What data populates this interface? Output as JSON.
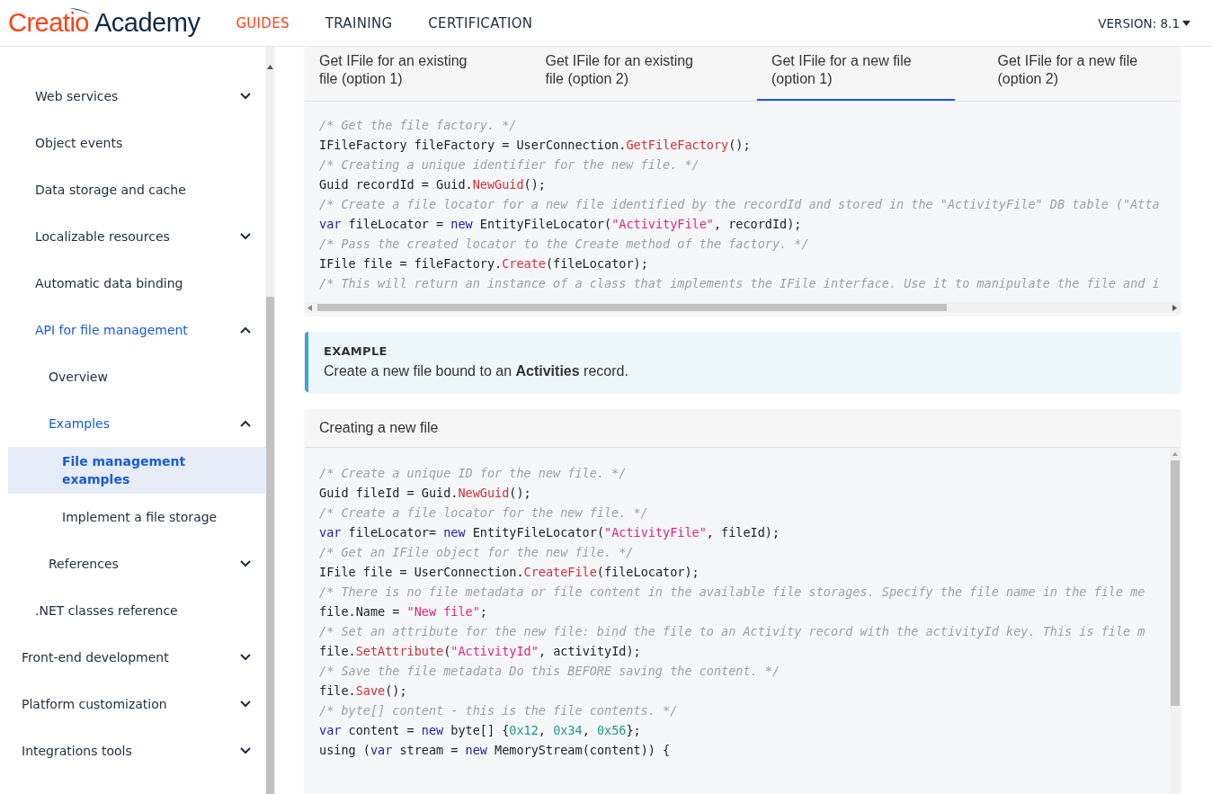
{
  "header": {
    "logo": {
      "brand": "Creatio",
      "name": "Academy"
    },
    "nav": [
      {
        "label": "GUIDES",
        "selected": true
      },
      {
        "label": "TRAINING",
        "selected": false
      },
      {
        "label": "CERTIFICATION",
        "selected": false
      }
    ],
    "version": "VERSION: 8.1"
  },
  "sidebar": {
    "section_items": [
      {
        "label": "Web services",
        "expanded": false,
        "selected": false
      },
      {
        "label": "Object events",
        "selected": false
      },
      {
        "label": "Data storage and cache",
        "selected": false
      },
      {
        "label": "Localizable resources",
        "expanded": false,
        "selected": false
      },
      {
        "label": "Automatic data binding",
        "selected": false
      },
      {
        "label": "API for file management",
        "expanded": true,
        "selected": false,
        "children": [
          {
            "label": "Overview",
            "selected": false
          },
          {
            "label": "Examples",
            "expanded": true,
            "selected": false,
            "children": [
              {
                "label": "File management examples",
                "selected": true
              },
              {
                "label": "Implement a file storage",
                "selected": false
              }
            ]
          },
          {
            "label": "References",
            "expanded": false,
            "selected": false
          }
        ]
      },
      {
        "label": ".NET classes reference",
        "selected": false
      }
    ],
    "items": [
      {
        "label": "Front-end development",
        "expanded": false,
        "selected": false
      },
      {
        "label": "Platform customization",
        "expanded": false,
        "selected": false
      },
      {
        "label": "Integrations tools",
        "expanded": false,
        "selected": false
      }
    ]
  },
  "tabs": [
    {
      "label": "Get IFile for an existing file (option 1)",
      "selected": false
    },
    {
      "label": "Get IFile for an existing file (option 2)",
      "selected": false
    },
    {
      "label": "Get IFile for a new file (option 1)",
      "selected": true
    },
    {
      "label": "Get IFile for a new file (option 2)",
      "selected": false
    }
  ],
  "code_1": [
    [
      {
        "kind": "comment",
        "text": "/* Get the file factory. */"
      }
    ],
    [
      {
        "kind": "plain",
        "text": "IFileFactory fileFactory = UserConnection."
      },
      {
        "kind": "method",
        "text": "GetFileFactory"
      },
      {
        "kind": "plain",
        "text": "();"
      }
    ],
    [
      {
        "kind": "comment",
        "text": "/* Creating a unique identifier for the new file. */"
      }
    ],
    [
      {
        "kind": "plain",
        "text": "Guid recordId = Guid."
      },
      {
        "kind": "method",
        "text": "NewGuid"
      },
      {
        "kind": "plain",
        "text": "();"
      }
    ],
    [
      {
        "kind": "comment",
        "text": "/* Create a file locator for a new file identified by the recordId and stored in the \"ActivityFile\" DB table (\"Atta"
      }
    ],
    [
      {
        "kind": "keyword",
        "text": "var"
      },
      {
        "kind": "plain",
        "text": " fileLocator = "
      },
      {
        "kind": "keyword",
        "text": "new"
      },
      {
        "kind": "plain",
        "text": " EntityFileLocator("
      },
      {
        "kind": "string",
        "text": "\"ActivityFile\""
      },
      {
        "kind": "plain",
        "text": ", recordId);"
      }
    ],
    [
      {
        "kind": "comment",
        "text": "/* Pass the created locator to the Create method of the factory. */"
      }
    ],
    [
      {
        "kind": "plain",
        "text": "IFile file = fileFactory."
      },
      {
        "kind": "method",
        "text": "Create"
      },
      {
        "kind": "plain",
        "text": "(fileLocator);"
      }
    ],
    [
      {
        "kind": "comment",
        "text": "/* This will return an instance of a class that implements the IFile interface. Use it to manipulate the file and i"
      }
    ]
  ],
  "example": {
    "label": "EXAMPLE",
    "text": "Create a new file bound to an **Activities** record."
  },
  "code_card": {
    "title": "Creating a new file",
    "lines": [
      [
        {
          "kind": "comment",
          "text": "/* Create a unique ID for the new file. */"
        }
      ],
      [
        {
          "kind": "plain",
          "text": "Guid fileId = Guid."
        },
        {
          "kind": "method",
          "text": "NewGuid"
        },
        {
          "kind": "plain",
          "text": "();"
        }
      ],
      [
        {
          "kind": "comment",
          "text": "/* Create a file locator for the new file. */"
        }
      ],
      [
        {
          "kind": "keyword",
          "text": "var"
        },
        {
          "kind": "plain",
          "text": " fileLocator= "
        },
        {
          "kind": "keyword",
          "text": "new"
        },
        {
          "kind": "plain",
          "text": " EntityFileLocator("
        },
        {
          "kind": "string",
          "text": "\"ActivityFile\""
        },
        {
          "kind": "plain",
          "text": ", fileId);"
        }
      ],
      [
        {
          "kind": "comment",
          "text": "/* Get an IFile object for the new file. */"
        }
      ],
      [
        {
          "kind": "plain",
          "text": "IFile file = UserConnection."
        },
        {
          "kind": "method",
          "text": "CreateFile"
        },
        {
          "kind": "plain",
          "text": "(fileLocator);"
        }
      ],
      [
        {
          "kind": "comment",
          "text": "/* There is no file metadata or file content in the available file storages. Specify the file name in the file me"
        }
      ],
      [
        {
          "kind": "plain",
          "text": "file.Name = "
        },
        {
          "kind": "string",
          "text": "\"New file\""
        },
        {
          "kind": "plain",
          "text": ";"
        }
      ],
      [
        {
          "kind": "comment",
          "text": "/* Set an attribute for the new file: bind the file to an Activity record with the activityId key. This is file m"
        }
      ],
      [
        {
          "kind": "plain",
          "text": "file."
        },
        {
          "kind": "method",
          "text": "SetAttribute"
        },
        {
          "kind": "plain",
          "text": "("
        },
        {
          "kind": "string",
          "text": "\"ActivityId\""
        },
        {
          "kind": "plain",
          "text": ", activityId);"
        }
      ],
      [
        {
          "kind": "comment",
          "text": "/* Save the file metadata Do this BEFORE saving the content. */"
        }
      ],
      [
        {
          "kind": "plain",
          "text": "file."
        },
        {
          "kind": "method",
          "text": "Save"
        },
        {
          "kind": "plain",
          "text": "();"
        }
      ],
      [
        {
          "kind": "comment",
          "text": "/* byte[] content - this is the file contents. */"
        }
      ],
      [
        {
          "kind": "keyword",
          "text": "var"
        },
        {
          "kind": "plain",
          "text": " content = "
        },
        {
          "kind": "keyword",
          "text": "new"
        },
        {
          "kind": "plain",
          "text": " byte[] {"
        },
        {
          "kind": "number",
          "text": "0x12"
        },
        {
          "kind": "plain",
          "text": ", "
        },
        {
          "kind": "number",
          "text": "0x34"
        },
        {
          "kind": "plain",
          "text": ", "
        },
        {
          "kind": "number",
          "text": "0x56"
        },
        {
          "kind": "plain",
          "text": "};"
        }
      ],
      [
        {
          "kind": "plain",
          "text": "using ("
        },
        {
          "kind": "keyword",
          "text": "var"
        },
        {
          "kind": "plain",
          "text": " stream = "
        },
        {
          "kind": "keyword",
          "text": "new"
        },
        {
          "kind": "plain",
          "text": " MemoryStream(content)) {"
        }
      ]
    ]
  }
}
